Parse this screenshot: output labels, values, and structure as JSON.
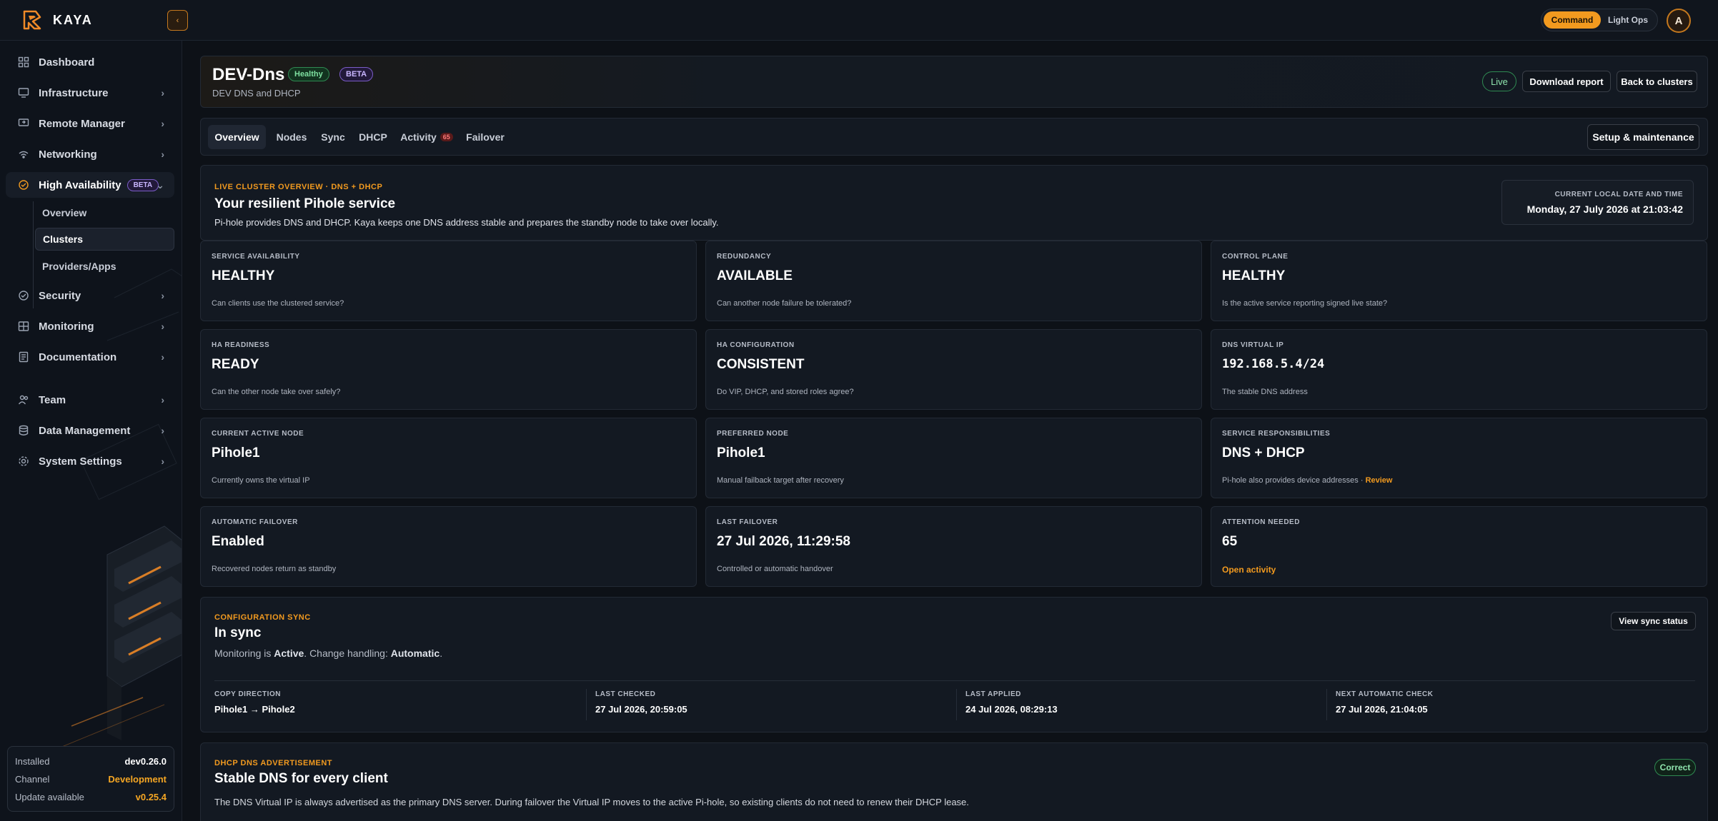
{
  "app": {
    "name": "KAYA"
  },
  "topbar": {
    "collapse_glyph": "‹",
    "modes": [
      "Command",
      "Light Ops"
    ],
    "active_mode": "Command",
    "avatar_initial": "A"
  },
  "sidebar": {
    "items": [
      {
        "label": "Dashboard",
        "icon": "dashboard-icon"
      },
      {
        "label": "Infrastructure",
        "icon": "monitor-icon"
      },
      {
        "label": "Remote Manager",
        "icon": "remote-icon"
      },
      {
        "label": "Networking",
        "icon": "wifi-icon"
      },
      {
        "label": "High Availability",
        "icon": "ha-icon",
        "badge": "BETA",
        "expanded": true
      },
      {
        "label": "Security",
        "icon": "shield-icon"
      },
      {
        "label": "Monitoring",
        "icon": "grid-icon"
      },
      {
        "label": "Documentation",
        "icon": "doc-icon"
      },
      {
        "label": "Team",
        "icon": "team-icon"
      },
      {
        "label": "Data Management",
        "icon": "database-icon"
      },
      {
        "label": "System Settings",
        "icon": "gear-icon"
      }
    ],
    "sub_items": [
      {
        "label": "Overview"
      },
      {
        "label": "Clusters",
        "active": true
      },
      {
        "label": "Providers/Apps"
      }
    ],
    "version": {
      "installed_label": "Installed",
      "installed_value": "dev0.26.0",
      "channel_label": "Channel",
      "channel_value": "Development",
      "update_label": "Update available",
      "update_value": "v0.25.4"
    }
  },
  "header": {
    "title": "DEV-Dns",
    "status_badge": "Healthy",
    "beta_badge": "BETA",
    "subtitle": "DEV DNS and DHCP",
    "live": "Live",
    "download_report": "Download report",
    "back": "Back to clusters"
  },
  "tabs": {
    "items": [
      "Overview",
      "Nodes",
      "Sync",
      "DHCP",
      "Activity",
      "Failover"
    ],
    "active": "Overview",
    "activity_count": "65",
    "setup": "Setup & maintenance"
  },
  "overview": {
    "eyebrow": "LIVE CLUSTER OVERVIEW · DNS + DHCP",
    "title": "Your resilient Pihole service",
    "description": "Pi-hole provides DNS and DHCP. Kaya keeps one DNS address stable and prepares the standby node to take over locally.",
    "clock_label": "CURRENT LOCAL DATE AND TIME",
    "clock_value": "Monday, 27 July 2026 at 21:03:42"
  },
  "stats": [
    {
      "label": "SERVICE AVAILABILITY",
      "value": "HEALTHY",
      "hint": "Can clients use the clustered service?"
    },
    {
      "label": "REDUNDANCY",
      "value": "AVAILABLE",
      "hint": "Can another node failure be tolerated?"
    },
    {
      "label": "CONTROL PLANE",
      "value": "HEALTHY",
      "hint": "Is the active service reporting signed live state?"
    },
    {
      "label": "HA READINESS",
      "value": "READY",
      "hint": "Can the other node take over safely?"
    },
    {
      "label": "HA CONFIGURATION",
      "value": "CONSISTENT",
      "hint": "Do VIP, DHCP, and stored roles agree?"
    },
    {
      "label": "DNS VIRTUAL IP",
      "value": "192.168.5.4/24",
      "hint": "The stable DNS address"
    },
    {
      "label": "CURRENT ACTIVE NODE",
      "value": "Pihole1",
      "hint": "Currently owns the virtual IP"
    },
    {
      "label": "PREFERRED NODE",
      "value": "Pihole1",
      "hint": "Manual failback target after recovery"
    },
    {
      "label": "SERVICE RESPONSIBILITIES",
      "value": "DNS + DHCP",
      "hint": "Pi-hole also provides device addresses ·",
      "link": "Review"
    },
    {
      "label": "AUTOMATIC FAILOVER",
      "value": "Enabled",
      "hint": "Recovered nodes return as standby"
    },
    {
      "label": "LAST FAILOVER",
      "value": "27 Jul 2026, 11:29:58",
      "hint": "Controlled or automatic handover"
    },
    {
      "label": "ATTENTION NEEDED",
      "value": "65",
      "hint": "Open activity"
    }
  ],
  "sync": {
    "eyebrow": "CONFIGURATION SYNC",
    "title": "In sync",
    "monitoring_prefix": "Monitoring is",
    "monitoring_value": "Active",
    "handling_prefix": ". Change handling:",
    "handling_value": "Automatic",
    "handling_suffix": ".",
    "button": "View sync status",
    "columns": [
      {
        "label": "COPY DIRECTION",
        "value": "Pihole1 → Pihole2"
      },
      {
        "label": "LAST CHECKED",
        "value": "27 Jul 2026, 20:59:05"
      },
      {
        "label": "LAST APPLIED",
        "value": "24 Jul 2026, 08:29:13"
      },
      {
        "label": "NEXT AUTOMATIC CHECK",
        "value": "27 Jul 2026, 21:04:05"
      }
    ]
  },
  "dhcp": {
    "eyebrow": "DHCP DNS ADVERTISEMENT",
    "title": "Stable DNS for every client",
    "description": "The DNS Virtual IP is always advertised as the primary DNS server. During failover the Virtual IP moves to the active Pi-hole, so existing clients do not need to renew their DHCP lease.",
    "status": "Correct"
  },
  "colors": {
    "accent": "#f29a1f",
    "success": "#2f8a52",
    "beta": "#7b5cc8",
    "background": "#0d1117"
  }
}
